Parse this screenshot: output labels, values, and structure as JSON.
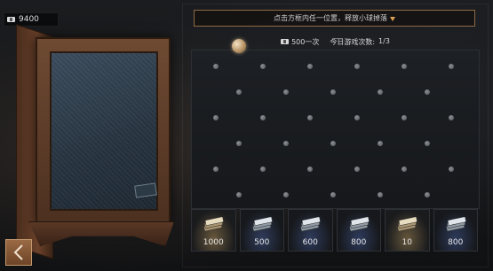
{
  "currency": {
    "icon": "ticket-icon",
    "amount": "9400"
  },
  "instruction": {
    "text": "点击方框内任一位置，释放小球掉落",
    "icon": "arrow-down-icon",
    "icon_color": "#e0a050"
  },
  "header": {
    "cost_icon": "ticket-icon",
    "cost_text": "500一次",
    "attempts_label": "今日游戏次数:",
    "attempts_value": "1/3"
  },
  "slots": [
    {
      "icon": "cash-bundle-gold",
      "reward": "1000",
      "glow": "warm"
    },
    {
      "icon": "cash-bundle-silver",
      "reward": "500",
      "glow": "cool"
    },
    {
      "icon": "cash-bundle-silver",
      "reward": "600",
      "glow": "cool"
    },
    {
      "icon": "cash-bundle-silver",
      "reward": "800",
      "glow": "cool"
    },
    {
      "icon": "cash-bundle-gold",
      "reward": "10",
      "glow": "warm"
    },
    {
      "icon": "cash-bundle-silver",
      "reward": "800",
      "glow": "cool"
    }
  ],
  "back_button": {
    "icon": "chevron-left-icon"
  },
  "colors": {
    "accent_border": "#8f6a44",
    "back_button": "#8a5c3a"
  }
}
